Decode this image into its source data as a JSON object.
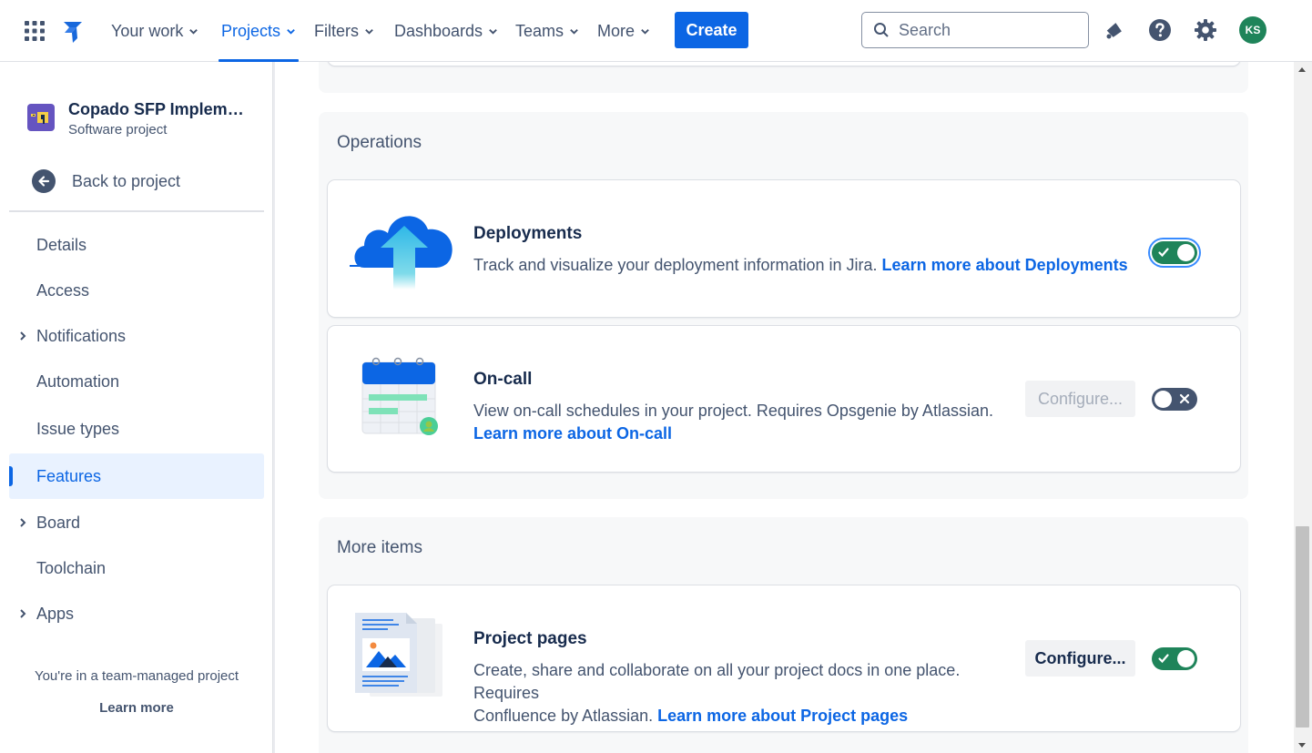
{
  "topnav": {
    "items": [
      {
        "label": "Your work"
      },
      {
        "label": "Projects"
      },
      {
        "label": "Filters"
      },
      {
        "label": "Dashboards"
      },
      {
        "label": "Teams"
      },
      {
        "label": "More"
      }
    ],
    "active": "Projects",
    "create_label": "Create",
    "search_placeholder": "Search",
    "avatar_initials": "KS"
  },
  "sidebar": {
    "project_name": "Copado SFP Implement...",
    "project_type": "Software project",
    "back_label": "Back to project",
    "items": [
      {
        "label": "Details"
      },
      {
        "label": "Access"
      },
      {
        "label": "Notifications"
      },
      {
        "label": "Automation"
      },
      {
        "label": "Issue types"
      },
      {
        "label": "Features"
      },
      {
        "label": "Board"
      },
      {
        "label": "Toolchain"
      },
      {
        "label": "Apps"
      }
    ],
    "selected": "Features",
    "team_note": "You're in a team-managed project",
    "learn_more": "Learn more"
  },
  "main": {
    "operations": {
      "title": "Operations",
      "deployments": {
        "title": "Deployments",
        "desc": "Track and visualize your deployment information in Jira. ",
        "link": "Learn more about Deployments",
        "enabled": true
      },
      "oncall": {
        "title": "On-call",
        "desc": "View on-call schedules in your project. Requires Opsgenie by Atlassian.",
        "link": "Learn more about On-call",
        "configure_label": "Configure...",
        "enabled": false
      }
    },
    "more_items": {
      "title": "More items",
      "project_pages": {
        "title": "Project pages",
        "desc_line1": "Create, share and collaborate on all your project docs in one place. Requires",
        "desc_line2": "Confluence by Atlassian. ",
        "link": "Learn more about Project pages",
        "configure_label": "Configure...",
        "enabled": true
      }
    }
  },
  "colors": {
    "accent": "#0c66e4",
    "toggle_on": "#1f845a",
    "toggle_off": "#44546f",
    "avatar_bg": "#1f845a",
    "project_avatar": "#6554c0"
  },
  "icons": [
    "apps-grid-icon",
    "jira-logo-icon",
    "chevron-down-icon",
    "search-icon",
    "notification-bell-icon",
    "help-icon",
    "settings-gear-icon",
    "arrow-left-icon",
    "chevron-right-icon",
    "check-icon",
    "cross-icon"
  ]
}
